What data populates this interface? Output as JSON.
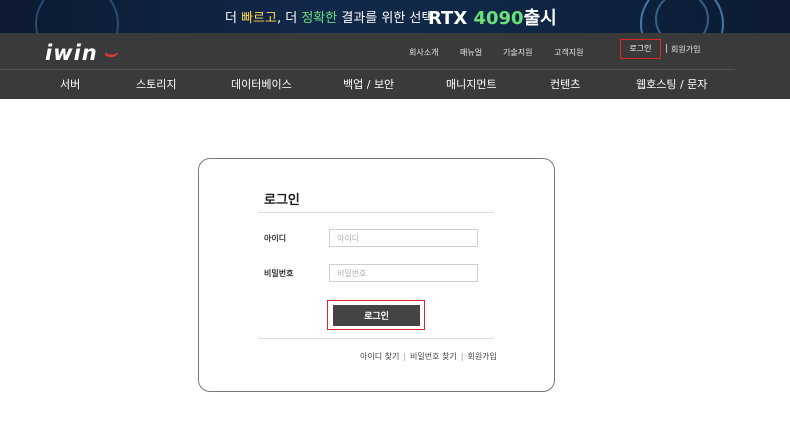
{
  "banner": {
    "text_prefix": "더 ",
    "text_fast": "빠르고",
    "text_mid": ", 더 ",
    "text_accurate": "정확한",
    "text_suffix": " 결과를 위한 선택",
    "rtx_prefix": "RTX ",
    "rtx_number": "4090",
    "rtx_suffix": "출시"
  },
  "header": {
    "logo_text": "iwin",
    "logo_mark": " ⌣",
    "top_links": [
      "회사소개",
      "매뉴얼",
      "기술지원",
      "고객지원"
    ],
    "login_link": "로그인",
    "join_link": "회원가입"
  },
  "nav": [
    "서버",
    "스토리지",
    "데이터베이스",
    "백업 / 보안",
    "매니지먼트",
    "컨텐츠",
    "웹호스팅 / 문자"
  ],
  "login": {
    "title": "로그인",
    "id_label": "아이디",
    "id_placeholder": "아이디",
    "pw_label": "비밀번호",
    "pw_placeholder": "비밀번호",
    "submit_label": "로그인",
    "link_find_id": "아이디 찾기",
    "link_find_pw": "비밀번호 찾기",
    "link_join": "회원가입",
    "separator": "|"
  },
  "colors": {
    "header_bg": "#3a3a3a",
    "banner_bg": "#0f1f36",
    "highlight_red": "#d8262b",
    "button_bg": "#444444"
  }
}
